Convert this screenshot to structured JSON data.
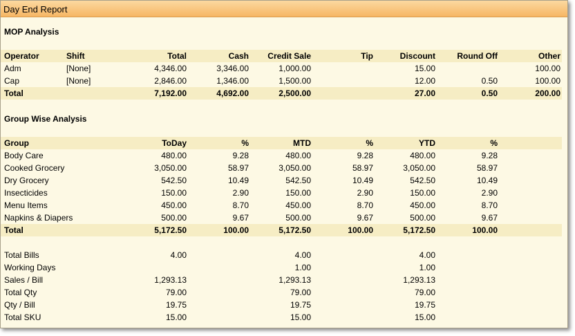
{
  "title": "Day End Report",
  "mop": {
    "heading": "MOP Analysis",
    "columns": [
      "Operator",
      "Shift",
      "Total",
      "Cash",
      "Credit Sale",
      "Tip",
      "Discount",
      "Round Off",
      "Other"
    ],
    "rows": [
      [
        "Adm",
        "[None]",
        "4,346.00",
        "3,346.00",
        "1,000.00",
        "",
        "15.00",
        "",
        "100.00"
      ],
      [
        "Cap",
        "[None]",
        "2,846.00",
        "1,346.00",
        "1,500.00",
        "",
        "12.00",
        "0.50",
        "100.00"
      ]
    ],
    "total": [
      "Total",
      "",
      "7,192.00",
      "4,692.00",
      "2,500.00",
      "",
      "27.00",
      "0.50",
      "200.00"
    ]
  },
  "group": {
    "heading": "Group Wise Analysis",
    "columns": [
      "Group",
      "ToDay",
      "%",
      "MTD",
      "%",
      "YTD",
      "%"
    ],
    "rows": [
      [
        "Body Care",
        "480.00",
        "9.28",
        "480.00",
        "9.28",
        "480.00",
        "9.28"
      ],
      [
        "Cooked Grocery",
        "3,050.00",
        "58.97",
        "3,050.00",
        "58.97",
        "3,050.00",
        "58.97"
      ],
      [
        "Dry Grocery",
        "542.50",
        "10.49",
        "542.50",
        "10.49",
        "542.50",
        "10.49"
      ],
      [
        "Insecticides",
        "150.00",
        "2.90",
        "150.00",
        "2.90",
        "150.00",
        "2.90"
      ],
      [
        "Menu Items",
        "450.00",
        "8.70",
        "450.00",
        "8.70",
        "450.00",
        "8.70"
      ],
      [
        "Napkins & Diapers",
        "500.00",
        "9.67",
        "500.00",
        "9.67",
        "500.00",
        "9.67"
      ]
    ],
    "total": [
      "Total",
      "5,172.50",
      "100.00",
      "5,172.50",
      "100.00",
      "5,172.50",
      "100.00"
    ]
  },
  "summary": {
    "rows": [
      [
        "Total Bills",
        "4.00",
        "4.00",
        "4.00"
      ],
      [
        "Working Days",
        "",
        "1.00",
        "1.00"
      ],
      [
        "Sales / Bill",
        "1,293.13",
        "1,293.13",
        "1,293.13"
      ],
      [
        "Total Qty",
        "79.00",
        "79.00",
        "79.00"
      ],
      [
        "Qty / Bill",
        "19.75",
        "19.75",
        "19.75"
      ],
      [
        "Total SKU",
        "15.00",
        "15.00",
        "15.00"
      ]
    ]
  }
}
